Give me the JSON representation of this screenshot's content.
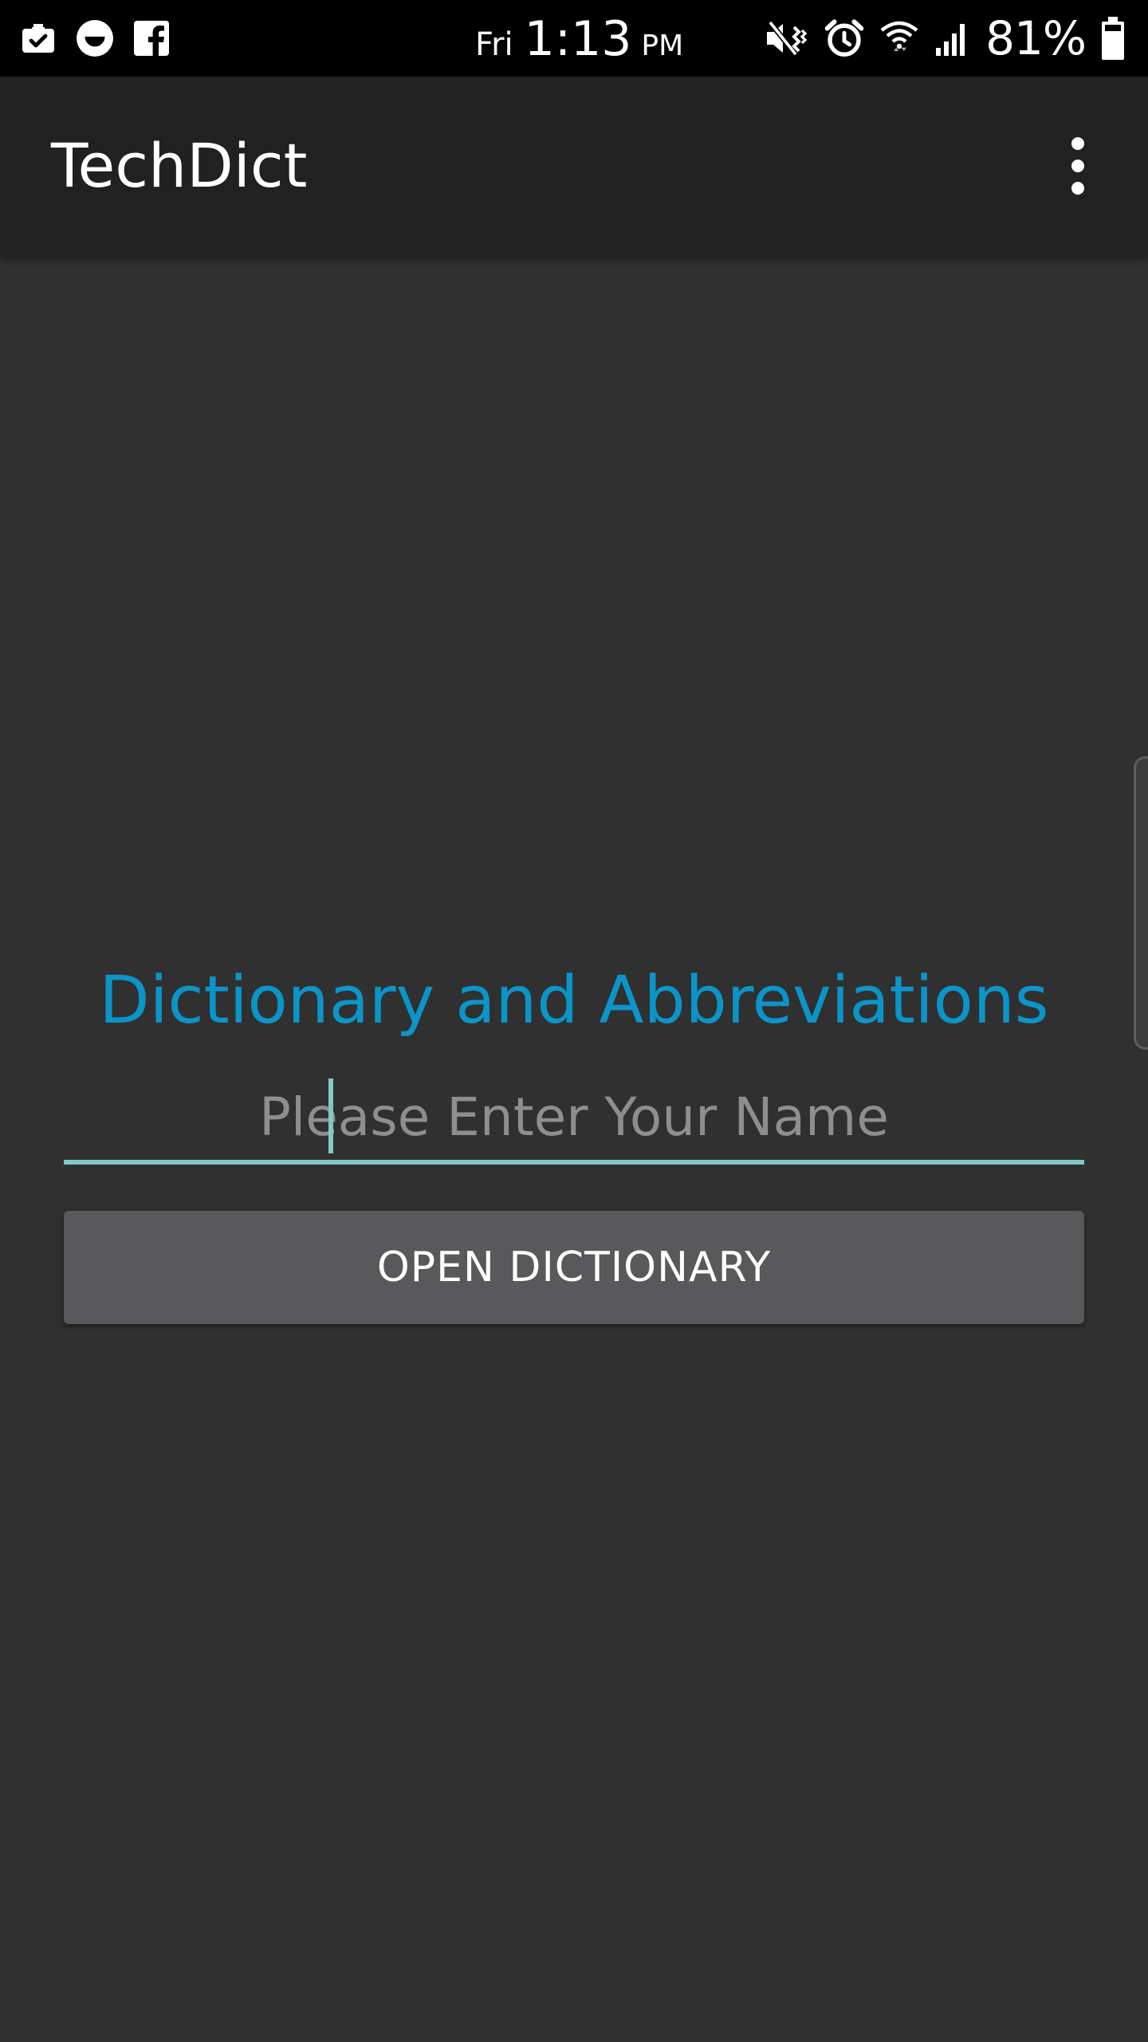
{
  "status_bar": {
    "day": "Fri",
    "time": "1:13",
    "ampm": "PM",
    "battery": "81%",
    "icons_left": [
      "briefcase-check-icon",
      "smiley-icon",
      "facebook-icon"
    ],
    "icons_right": [
      "vibrate-mute-icon",
      "alarm-icon",
      "wifi-icon",
      "signal-icon",
      "battery-icon"
    ]
  },
  "app_bar": {
    "title": "TechDict",
    "menu_icon": "more-vert-icon"
  },
  "main": {
    "heading": "Dictionary and Abbreviations",
    "name_input": {
      "placeholder": "Please Enter Your Name",
      "value": ""
    },
    "open_button": "OPEN DICTIONARY"
  },
  "colors": {
    "accent": "#0a95c9",
    "underline": "#7fcbc4",
    "background": "#303030",
    "app_bar": "#212121",
    "button": "#59595b"
  }
}
